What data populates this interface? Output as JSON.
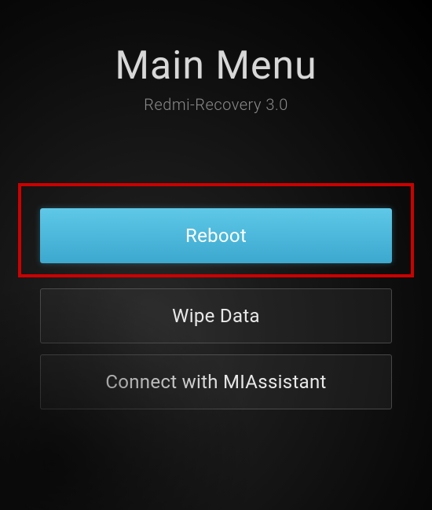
{
  "header": {
    "title": "Main Menu",
    "subtitle": "Redmi-Recovery 3.0"
  },
  "menu": {
    "items": [
      {
        "label": "Reboot",
        "selected": true
      },
      {
        "label": "Wipe Data",
        "selected": false
      },
      {
        "label": "Connect with MIAssistant",
        "selected": false
      }
    ]
  }
}
